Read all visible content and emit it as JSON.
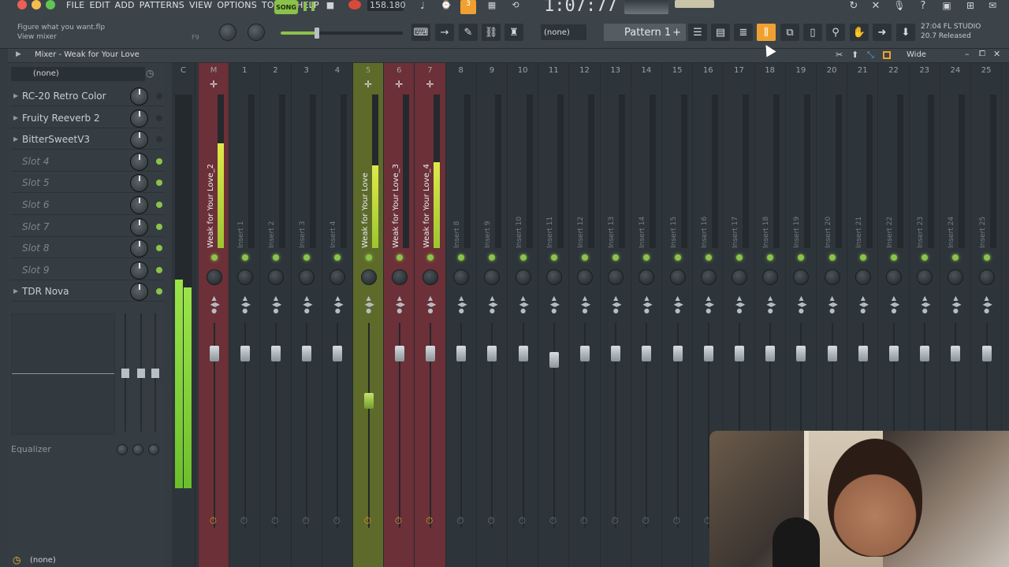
{
  "menu": [
    "FILE",
    "EDIT",
    "ADD",
    "PATTERNS",
    "VIEW",
    "OPTIONS",
    "TOOLS",
    "HELP"
  ],
  "transport": {
    "song_label": "SONG",
    "tempo": "158.180",
    "time": "1:07:77"
  },
  "hint": {
    "line1": "Figure what you want.flp",
    "line2": "View mixer",
    "key": "F9"
  },
  "pattern_selector": {
    "none_label": "(none)",
    "pattern": "Pattern 1",
    "add": "+"
  },
  "version": {
    "line1": "27:04  FL STUDIO",
    "line2": "20.7 Released"
  },
  "mixer": {
    "title": "Mixer - Weak for Your Love",
    "view_mode": "Wide",
    "preset": "(none)",
    "route": "(none)",
    "equalizer_label": "Equalizer"
  },
  "slots": [
    {
      "name": "RC-20 Retro Color",
      "filled": true,
      "led": "off"
    },
    {
      "name": "Fruity Reeverb 2",
      "filled": true,
      "led": "off"
    },
    {
      "name": "BitterSweetV3",
      "filled": true,
      "led": "off"
    },
    {
      "name": "Slot 4",
      "filled": false,
      "led": "on"
    },
    {
      "name": "Slot 5",
      "filled": false,
      "led": "on"
    },
    {
      "name": "Slot 6",
      "filled": false,
      "led": "on"
    },
    {
      "name": "Slot 7",
      "filled": false,
      "led": "on"
    },
    {
      "name": "Slot 8",
      "filled": false,
      "led": "on"
    },
    {
      "name": "Slot 9",
      "filled": false,
      "led": "on"
    },
    {
      "name": "TDR Nova",
      "filled": true,
      "led": "on"
    }
  ],
  "master": {
    "label": "C",
    "meter_db_ticks": [
      "3",
      "0",
      "3",
      "6",
      "9",
      "12"
    ]
  },
  "tracks": [
    {
      "num": "M",
      "name": "Weak for Your Love_2",
      "active": true,
      "level": 0.68,
      "fader": 0.85,
      "tint": "#6b3038"
    },
    {
      "num": "1",
      "name": "Insert 1",
      "active": false,
      "level": 0,
      "fader": 0.85
    },
    {
      "num": "2",
      "name": "Insert 2",
      "active": false,
      "level": 0,
      "fader": 0.85
    },
    {
      "num": "3",
      "name": "Insert 3",
      "active": false,
      "level": 0,
      "fader": 0.85
    },
    {
      "num": "4",
      "name": "Insert 4",
      "active": false,
      "level": 0,
      "fader": 0.85
    },
    {
      "num": "5",
      "name": "Weak for Your Love",
      "active": true,
      "level": 0.54,
      "fader": 0.62,
      "tint": "#5e6a2a",
      "selected": true
    },
    {
      "num": "6",
      "name": "Weak for Your Love_3",
      "active": true,
      "level": 0,
      "fader": 0.85,
      "tint": "#6b3038"
    },
    {
      "num": "7",
      "name": "Weak for Your Love_4",
      "active": true,
      "level": 0.56,
      "fader": 0.85,
      "tint": "#6b3038"
    },
    {
      "num": "8",
      "name": "Insert 8",
      "active": false,
      "level": 0,
      "fader": 0.85
    },
    {
      "num": "9",
      "name": "Insert 9",
      "active": false,
      "level": 0,
      "fader": 0.85
    },
    {
      "num": "10",
      "name": "Insert 10",
      "active": false,
      "level": 0,
      "fader": 0.85
    },
    {
      "num": "11",
      "name": "Insert 11",
      "active": false,
      "level": 0,
      "fader": 0.82
    },
    {
      "num": "12",
      "name": "Insert 12",
      "active": false,
      "level": 0,
      "fader": 0.85
    },
    {
      "num": "13",
      "name": "Insert 13",
      "active": false,
      "level": 0,
      "fader": 0.85
    },
    {
      "num": "14",
      "name": "Insert 14",
      "active": false,
      "level": 0,
      "fader": 0.85
    },
    {
      "num": "15",
      "name": "Insert 15",
      "active": false,
      "level": 0,
      "fader": 0.85
    },
    {
      "num": "16",
      "name": "Insert 16",
      "active": false,
      "level": 0,
      "fader": 0.85
    },
    {
      "num": "17",
      "name": "Insert 17",
      "active": false,
      "level": 0,
      "fader": 0.85
    },
    {
      "num": "18",
      "name": "Insert 18",
      "active": false,
      "level": 0,
      "fader": 0.85
    },
    {
      "num": "19",
      "name": "Insert 19",
      "active": false,
      "level": 0,
      "fader": 0.85
    },
    {
      "num": "20",
      "name": "Insert 20",
      "active": false,
      "level": 0,
      "fader": 0.85
    },
    {
      "num": "21",
      "name": "Insert 21",
      "active": false,
      "level": 0,
      "fader": 0.85
    },
    {
      "num": "22",
      "name": "Insert 22",
      "active": false,
      "level": 0,
      "fader": 0.85
    },
    {
      "num": "23",
      "name": "Insert 23",
      "active": false,
      "level": 0,
      "fader": 0.85
    },
    {
      "num": "24",
      "name": "Insert 24",
      "active": false,
      "level": 0,
      "fader": 0.85
    },
    {
      "num": "25",
      "name": "Insert 25",
      "active": false,
      "level": 0,
      "fader": 0.85
    }
  ],
  "colors": {
    "accent": "#8bc34a",
    "highlight": "#f0a030"
  }
}
